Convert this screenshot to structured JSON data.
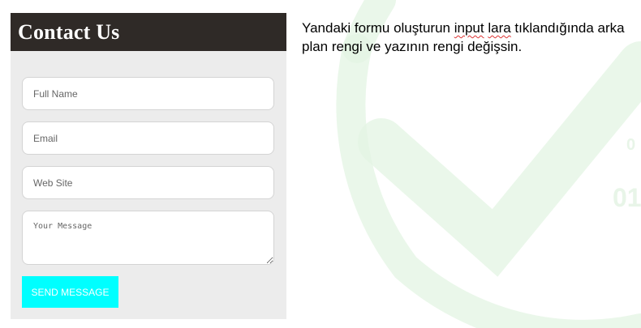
{
  "form": {
    "title": "Contact Us",
    "full_name_placeholder": "Full Name",
    "email_placeholder": "Email",
    "website_placeholder": "Web Site",
    "message_placeholder": "Your Message",
    "submit_label": "SEND MESSAGE"
  },
  "instructions": {
    "part1": "Yandaki formu oluşturun ",
    "word_input": "input",
    "space": " ",
    "word_lara": "lara",
    "part2": " tıklandığında arka plan rengi ve yazının rengi değişsin."
  },
  "colors": {
    "header_bg": "#2f2a27",
    "panel_bg": "#ececec",
    "button_bg": "#00ffff",
    "watermark": "#dff3df"
  },
  "icons": {
    "watermark": "checkmark-icon"
  }
}
